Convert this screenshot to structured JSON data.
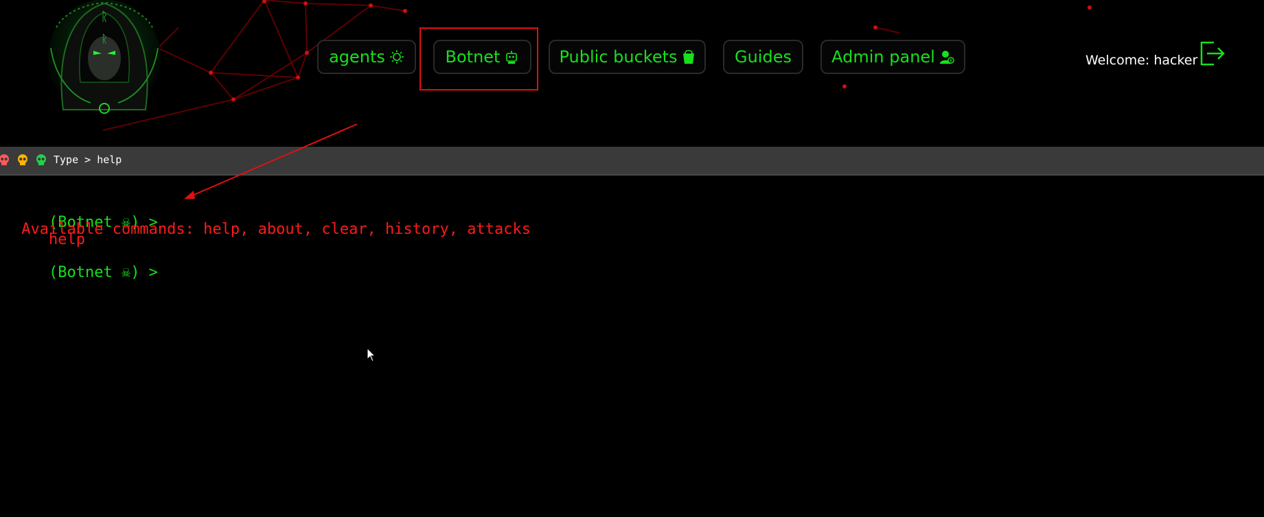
{
  "nav": {
    "items": [
      {
        "label": "agents",
        "icon": "sun-icon"
      },
      {
        "label": "Botnet",
        "icon": "robot-icon"
      },
      {
        "label": "Public buckets",
        "icon": "bucket-icon"
      },
      {
        "label": "Guides",
        "icon": ""
      },
      {
        "label": "Admin panel",
        "icon": "admin-user-icon"
      }
    ],
    "selected": "Botnet"
  },
  "header": {
    "welcome_text": "Welcome: hacker",
    "logout_icon": "logout-icon",
    "logo_icon": "hooded-figure-logo"
  },
  "terminal": {
    "bar_text": "Type > help",
    "bar_icons": [
      "skull-red-icon",
      "skull-yellow-icon",
      "skull-green-icon"
    ],
    "lines": [
      {
        "prompt": "(Botnet ☠) >",
        "command": "help"
      },
      {
        "output": " Available commands: help, about, clear, history, attacks"
      },
      {
        "prompt": "(Botnet ☠) >",
        "command": ""
      }
    ]
  },
  "colors": {
    "accent_green": "#17e01d",
    "accent_red": "#ff1a1a",
    "background": "#000000",
    "terminal_bar": "#3a3a3a"
  }
}
